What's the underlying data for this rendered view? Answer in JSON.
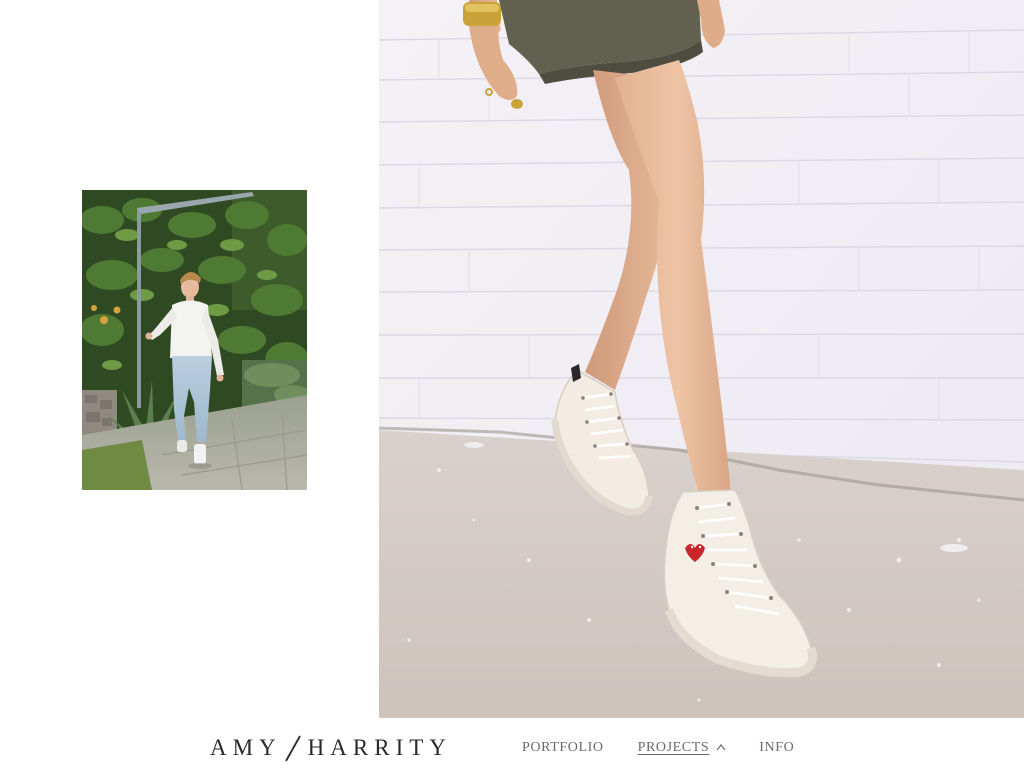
{
  "brand": {
    "left": "AMY",
    "right": "HARRITY"
  },
  "nav": {
    "items": [
      {
        "label": "PORTFOLIO",
        "active": false
      },
      {
        "label": "PROJECTS",
        "active": true,
        "icon": "chevron-up-icon"
      },
      {
        "label": "INFO",
        "active": false
      }
    ]
  },
  "colors": {
    "text_dark": "#2a2a2a",
    "nav_text": "#6b6b6b",
    "background": "#ffffff"
  }
}
